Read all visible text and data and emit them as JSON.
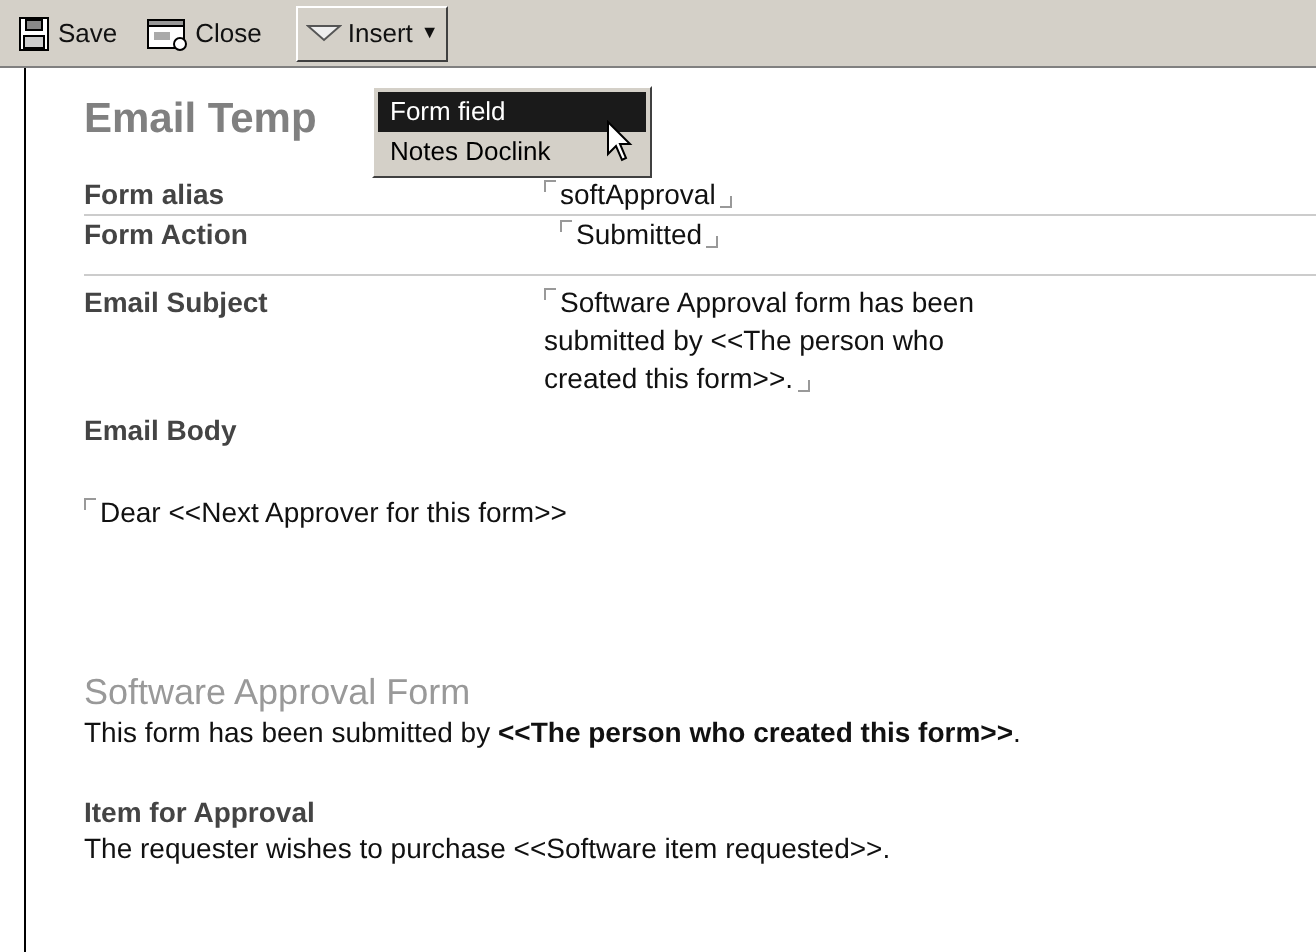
{
  "toolbar": {
    "buttons": [
      {
        "kind": "save",
        "label": "Save"
      },
      {
        "kind": "close",
        "label": "Close"
      },
      {
        "kind": "insert",
        "label": "Insert",
        "caret": "▼",
        "expanded": true
      }
    ]
  },
  "menu": {
    "items": [
      {
        "label": "Form field",
        "selected": true
      },
      {
        "label": "Notes Doclink",
        "selected": false
      }
    ]
  },
  "title": "Email Temp",
  "fields": [
    {
      "label": "Form alias",
      "value": "softApproval",
      "rule": true
    },
    {
      "label": "Form Action",
      "value": "Submitted",
      "rule": true
    },
    {
      "label": "Email Subject",
      "value": "Software Approval form has been submitted by <<The person who created this form>>.",
      "rule": false
    }
  ],
  "body_label": "Email Body",
  "body_field": "Dear <<Next Approver for this form>>",
  "form_heading": "Software Approval Form",
  "form_text": "This form has been submitted by **<<The person who created this form>>**.",
  "item_heading": "Item for Approval",
  "item_text": "The requester wishes to purchase <<Software item requested>>."
}
